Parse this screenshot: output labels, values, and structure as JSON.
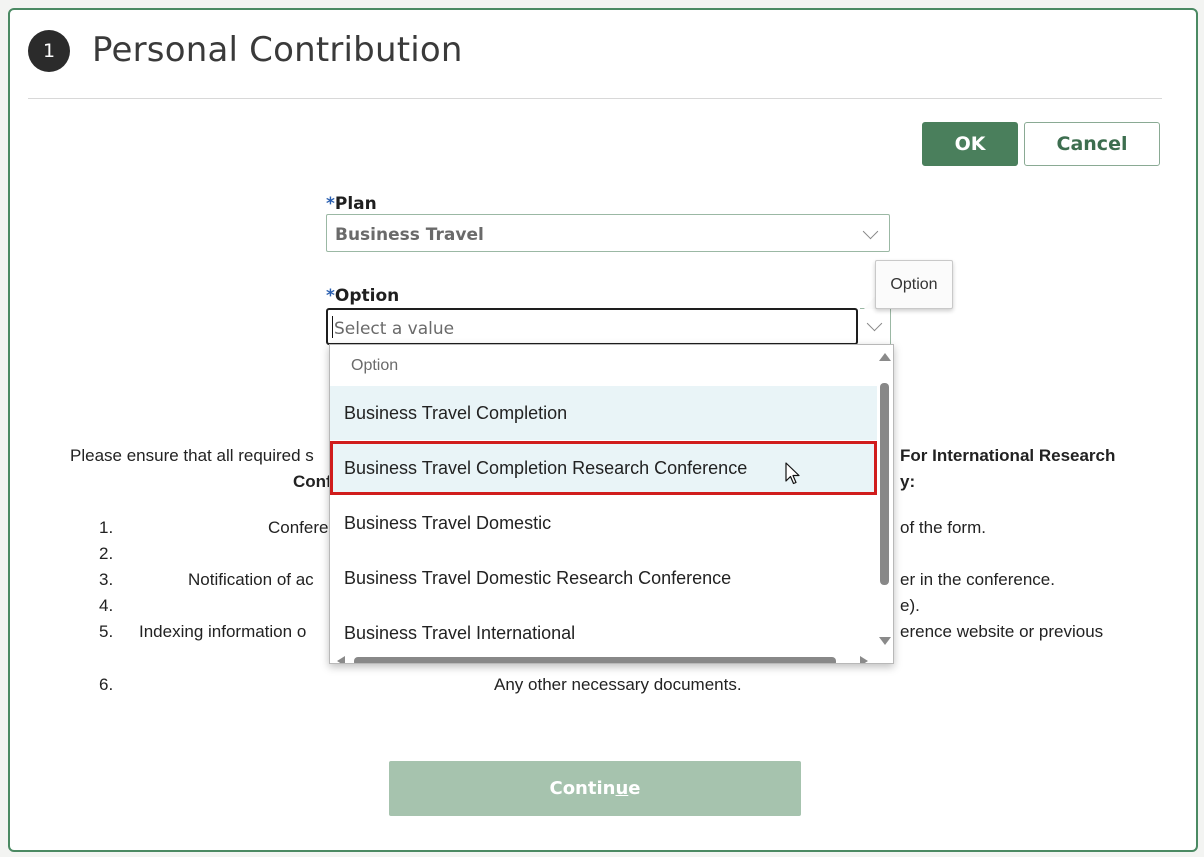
{
  "header": {
    "step_number": "1",
    "title": "Personal Contribution"
  },
  "actions": {
    "ok_label": "OK",
    "cancel_label": "Cancel"
  },
  "plan": {
    "label": "Plan",
    "required_mark": "*",
    "value": "Business Travel"
  },
  "option": {
    "label": "Option",
    "required_mark": "*",
    "placeholder": "Select a value",
    "tooltip": "Option"
  },
  "dropdown": {
    "header": "Option",
    "items": [
      "Business Travel Completion",
      "Business Travel Completion Research Conference",
      "Business Travel Domestic",
      "Business Travel Domestic Research Conference",
      "Business Travel International"
    ],
    "highlighted_index": 1
  },
  "instructions": {
    "intro_left": "Please ensure that all required s",
    "intro_right_bold": "For International Research",
    "line2_left_bold": "Conf",
    "line2_right_bold": "y:",
    "items": [
      {
        "num": "1.",
        "left": "Confere",
        "right": "of the form."
      },
      {
        "num": "2.",
        "left": "",
        "right": ""
      },
      {
        "num": "3.",
        "left": "Notification of ac",
        "right": "er in the conference."
      },
      {
        "num": "4.",
        "left": "",
        "right": "e)."
      },
      {
        "num": "5.",
        "left": "Indexing information o",
        "right": "erence website or previous"
      },
      {
        "num": "6.",
        "left": "Any other necessary documents.",
        "right": ""
      }
    ]
  },
  "footer": {
    "continue_pre": "Contin",
    "continue_underlined": "u",
    "continue_post": "e"
  }
}
